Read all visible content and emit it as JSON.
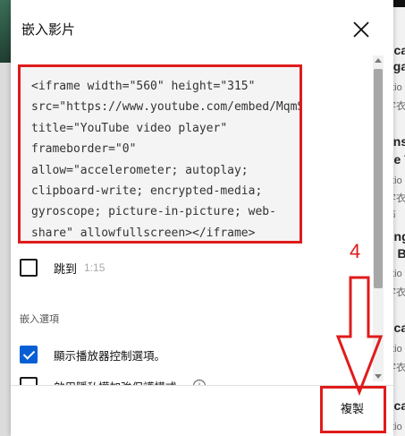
{
  "modal": {
    "title": "嵌入影片",
    "embed_code": "<iframe width=\"560\" height=\"315\" src=\"https://www.youtube.com/embed/MqmSMunAtss\" title=\"YouTube video player\" frameborder=\"0\" allow=\"accelerometer; autoplay; clipboard-write; encrypted-media; gyroscope; picture-in-picture; web-share\" allowfullscreen></iframe>",
    "start_at": {
      "label": "跳到",
      "time": "1:15",
      "checked": false
    },
    "options_heading": "嵌入選項",
    "options": [
      {
        "label": "顯示播放器控制選項。",
        "checked": true
      },
      {
        "label": "啟用隱私權加強保護模式。",
        "checked": false
      }
    ],
    "copy_label": "複製"
  },
  "annotation": {
    "step_number": "4",
    "color": "#e01b1b"
  },
  "background_text": {
    "items": [
      "dcas",
      "ega",
      "ritio",
      "字衣氣",
      "ens",
      "he T",
      "ritio",
      "字衣",
      "布",
      "ting",
      "h B",
      "ritio",
      "字衣氣",
      "dcas",
      "ritio",
      "字衣氣",
      "dcas",
      "ritio"
    ]
  },
  "colors": {
    "accent": "#065fd4",
    "highlight": "#e01b1b"
  },
  "icons": {
    "close": "close-icon",
    "info": "info-icon"
  }
}
